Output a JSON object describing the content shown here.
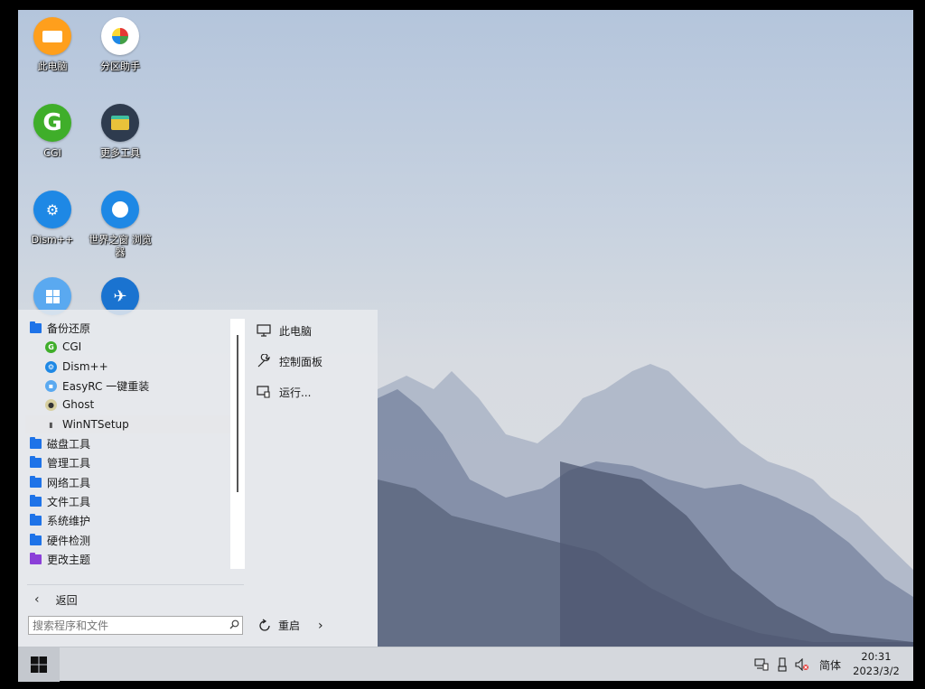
{
  "desktop": {
    "icons": [
      {
        "label": "此电脑",
        "icon": "computer-icon",
        "color": "#ff9f1c"
      },
      {
        "label": "分区助手",
        "icon": "partition-assistant-icon",
        "color": "#ffffff"
      },
      {
        "label": "CGI",
        "icon": "cgi-icon",
        "color": "#3fae2a"
      },
      {
        "label": "更多工具",
        "icon": "toolbox-icon",
        "color": "#2e3b4e"
      },
      {
        "label": "Dism++",
        "icon": "dism-icon",
        "color": "#1e88e5"
      },
      {
        "label": "世界之窗 浏览器",
        "icon": "browser-icon",
        "color": "#1e88e5"
      },
      {
        "label": "",
        "icon": "windows-setup-icon",
        "color": "#5aa9f0"
      },
      {
        "label": "",
        "icon": "bird-icon",
        "color": "#1a73d0"
      }
    ]
  },
  "startmenu": {
    "items": [
      {
        "label": "备份还原",
        "type": "folder"
      },
      {
        "label": "CGI",
        "type": "app",
        "icon": "cgi-icon",
        "color": "#3fae2a"
      },
      {
        "label": "Dism++",
        "type": "app",
        "icon": "dism-icon",
        "color": "#1e88e5"
      },
      {
        "label": "EasyRC 一键重装",
        "type": "app",
        "icon": "easyrc-icon",
        "color": "#5aa9f0"
      },
      {
        "label": "Ghost",
        "type": "app",
        "icon": "ghost-icon",
        "color": "#d8d0a0"
      },
      {
        "label": "WinNTSetup",
        "type": "app",
        "icon": "winntsetup-icon",
        "color": "#555555"
      },
      {
        "label": "磁盘工具",
        "type": "folder"
      },
      {
        "label": "管理工具",
        "type": "folder"
      },
      {
        "label": "网络工具",
        "type": "folder"
      },
      {
        "label": "文件工具",
        "type": "folder"
      },
      {
        "label": "系统维护",
        "type": "folder"
      },
      {
        "label": "硬件检测",
        "type": "folder"
      },
      {
        "label": "更改主题",
        "type": "folder-purple"
      }
    ],
    "back_label": "返回",
    "search_placeholder": "搜索程序和文件",
    "right_items": [
      {
        "label": "此电脑",
        "icon": "monitor-icon"
      },
      {
        "label": "控制面板",
        "icon": "wrench-icon"
      },
      {
        "label": "运行...",
        "icon": "run-icon"
      }
    ],
    "restart_label": "重启"
  },
  "taskbar": {
    "ime": "简体",
    "time": "20:31",
    "date": "2023/3/2",
    "tray_icons": [
      "network-icon",
      "usb-icon",
      "volume-muted-icon"
    ]
  },
  "colors": {
    "accent_folder": "#1e73e8",
    "theme_folder": "#8b3fd8"
  }
}
